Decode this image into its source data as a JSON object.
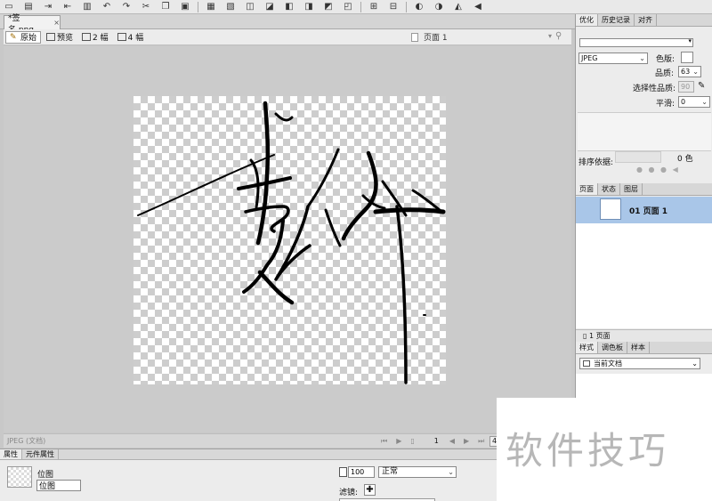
{
  "document": {
    "tab_title": "*签名.png",
    "close_glyph": "×"
  },
  "viewbar": {
    "original": "原始",
    "preview": "预览",
    "two_up": "2 幅",
    "four_up": "4 幅",
    "page_label": "页面 1"
  },
  "statusbar": {
    "info": "JPEG (文档)",
    "page_num": "1",
    "zoom": "4"
  },
  "properties": {
    "tab_props": "属性",
    "tab_symbol": "元件属性",
    "object_type": "位图",
    "object_name": "位图",
    "opacity": "100",
    "blend_mode": "正常",
    "filters_label": "滤镜:"
  },
  "optimize": {
    "tab_optimize": "优化",
    "tab_history": "历史记录",
    "tab_align": "对齐",
    "format": "JPEG",
    "matte_label": "色版:",
    "quality_label": "品质:",
    "quality": "63",
    "selective_quality_label": "选择性品质:",
    "selective_quality": "90",
    "smoothing_label": "平滑:",
    "smoothing": "0",
    "sort_label": "排序依据:",
    "colors_count": "0 色"
  },
  "pages": {
    "tab_pages": "页面",
    "tab_states": "状态",
    "tab_layers": "图层",
    "row_label": "01 页面 1",
    "footer": "1 页面"
  },
  "styles": {
    "tab_styles": "样式",
    "tab_swatches": "调色板",
    "tab_samples": "样本",
    "current": "当前文档"
  },
  "watermark": "软件技巧"
}
